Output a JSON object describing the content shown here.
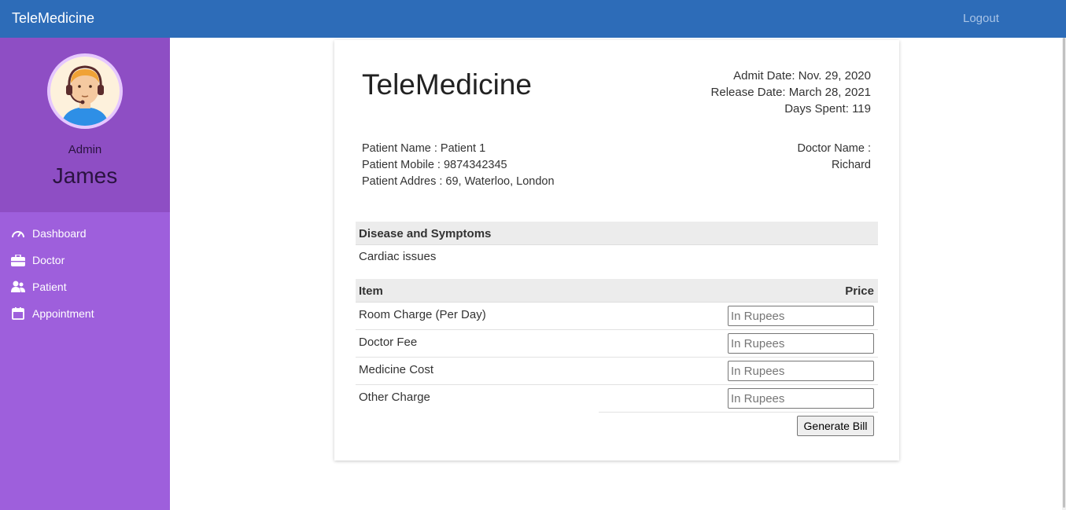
{
  "topbar": {
    "brand": "TeleMedicine",
    "logout": "Logout"
  },
  "sidebar": {
    "role": "Admin",
    "username": "James",
    "items": [
      {
        "label": "Dashboard",
        "icon": "gauge-icon"
      },
      {
        "label": "Doctor",
        "icon": "briefcase-icon"
      },
      {
        "label": "Patient",
        "icon": "user-icon"
      },
      {
        "label": "Appointment",
        "icon": "calendar-icon"
      }
    ]
  },
  "invoice": {
    "title": "TeleMedicine",
    "admit_date": "Admit Date: Nov. 29, 2020",
    "release_date": "Release Date: March 28, 2021",
    "days_spent": "Days Spent: 119",
    "patient_name": "Patient Name : Patient 1",
    "patient_mobile": "Patient Mobile : 9874342345",
    "patient_address": "Patient Addres : 69, Waterloo, London",
    "doctor_label": "Doctor Name :",
    "doctor_name": "Richard",
    "symptoms_header": "Disease and Symptoms",
    "symptoms": "Cardiac issues",
    "item_header": "Item",
    "price_header": "Price",
    "items": [
      {
        "label": "Room Charge (Per Day)",
        "placeholder": "In Rupees",
        "value": ""
      },
      {
        "label": "Doctor Fee",
        "placeholder": "In Rupees",
        "value": ""
      },
      {
        "label": "Medicine Cost",
        "placeholder": "In Rupees",
        "value": ""
      },
      {
        "label": "Other Charge",
        "placeholder": "In Rupees",
        "value": ""
      }
    ],
    "generate_button": "Generate Bill"
  },
  "colors": {
    "topbar": "#2d6cb8",
    "sidebar": "#9e5fdc",
    "profile_panel": "#8e4ec4"
  }
}
